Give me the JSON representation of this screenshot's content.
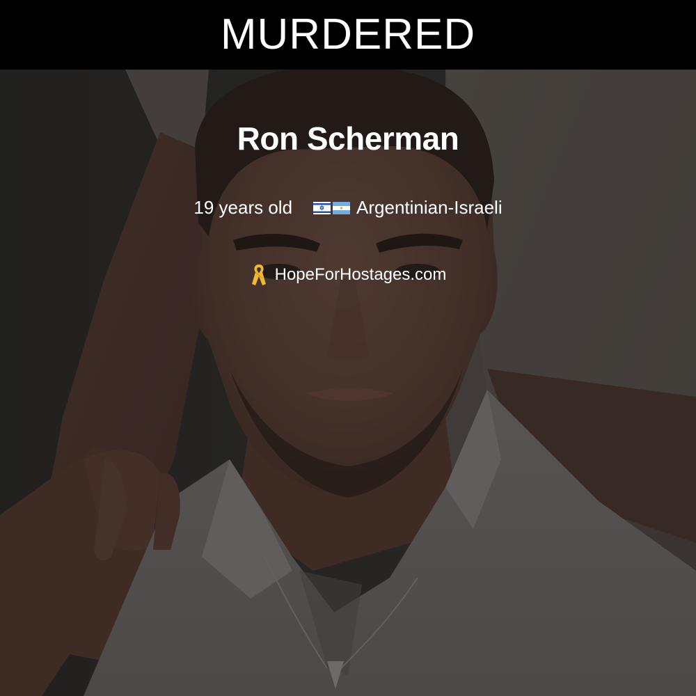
{
  "banner": {
    "status_label": "MURDERED"
  },
  "person": {
    "name": "Ron Scherman",
    "age_text": "19 years old",
    "nationality": "Argentinian-Israeli"
  },
  "footer": {
    "website": "HopeForHostages.com"
  },
  "icons": {
    "flag_1": "israel-flag-icon",
    "flag_2": "argentina-flag-icon",
    "ribbon": "yellow-ribbon-icon"
  },
  "colors": {
    "banner_background": "#000000",
    "text": "#ffffff",
    "ribbon": "#f2b632",
    "photo_tint": "#3f3733"
  }
}
